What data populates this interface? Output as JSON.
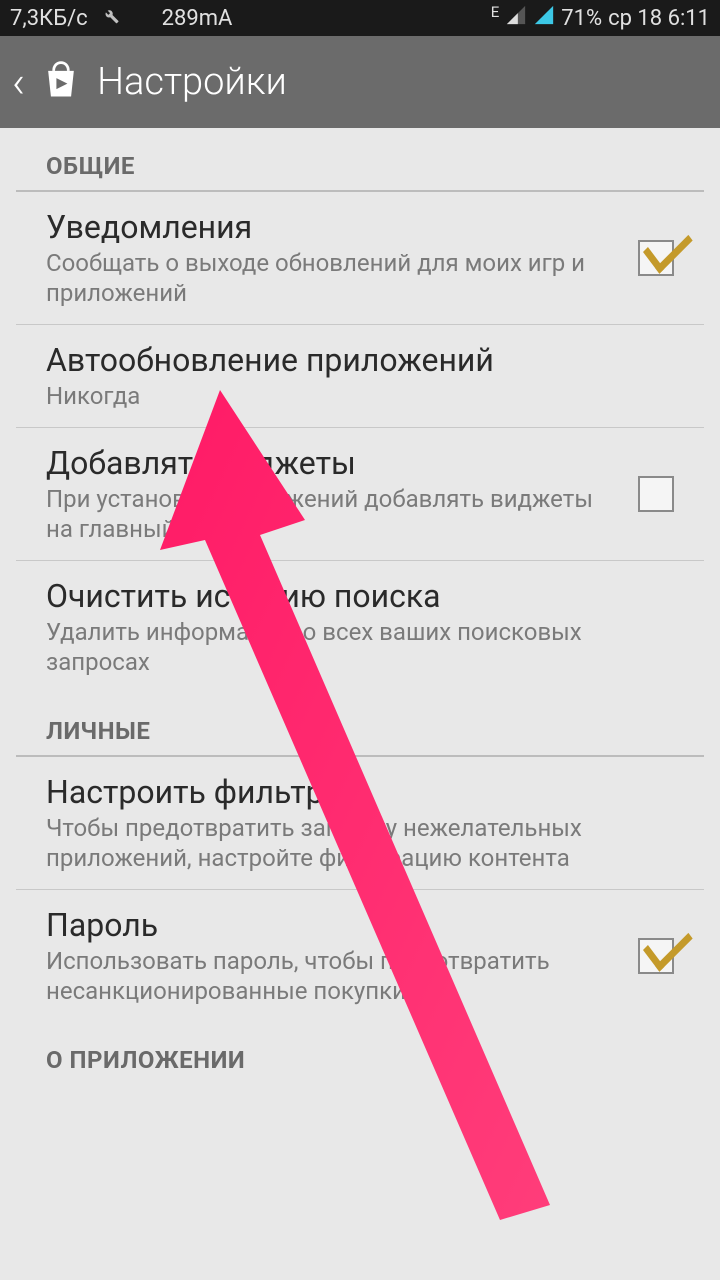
{
  "status": {
    "data_rate": "7,3КБ/с",
    "current": "289mA",
    "edge": "E",
    "battery": "71%",
    "date_time": "ср 18 6:11"
  },
  "header": {
    "title": "Настройки"
  },
  "sections": {
    "general": {
      "label": "ОБЩИЕ",
      "notifications": {
        "title": "Уведомления",
        "subtitle": "Сообщать о выходе обновлений для моих игр и приложений"
      },
      "autoupdate": {
        "title": "Автообновление приложений",
        "subtitle": "Никогда"
      },
      "widgets": {
        "title": "Добавлять виджеты",
        "subtitle": "При установке приложений добавлять виджеты на главный экран"
      },
      "clear_search": {
        "title": "Очистить историю поиска",
        "subtitle": "Удалить информацию о всех ваших поисковых запросах"
      }
    },
    "personal": {
      "label": "ЛИЧНЫЕ",
      "filter": {
        "title": "Настроить фильтр",
        "subtitle": "Чтобы предотвратить загрузку нежелательных приложений, настройте фильтрацию контента"
      },
      "password": {
        "title": "Пароль",
        "subtitle": "Использовать пароль, чтобы предотвратить несанкционированные покупки"
      }
    },
    "about": {
      "label": "О ПРИЛОЖЕНИИ"
    }
  }
}
